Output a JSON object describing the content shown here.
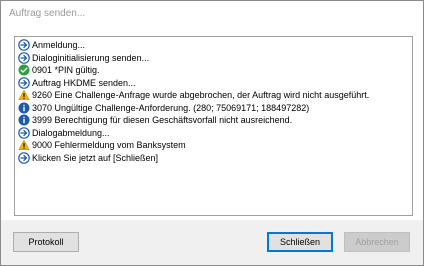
{
  "window": {
    "title": "Auftrag senden..."
  },
  "log": [
    {
      "icon": "arrow-right-icon",
      "text": "Anmeldung..."
    },
    {
      "icon": "arrow-right-icon",
      "text": "Dialoginitialisierung senden..."
    },
    {
      "icon": "checkmark-icon",
      "text": "0901 *PIN gültig."
    },
    {
      "icon": "arrow-right-icon",
      "text": "Auftrag HKDME senden..."
    },
    {
      "icon": "warning-icon",
      "text": "9260 Eine Challenge-Anfrage wurde abgebrochen, der Auftrag wird nicht ausgeführt."
    },
    {
      "icon": "info-icon",
      "text": "3070 Ungültige Challenge-Anforderung. (280; 75069171; 188497282)"
    },
    {
      "icon": "info-icon",
      "text": "3999 Berechtigung für diesen Geschäftsvorfall nicht ausreichend."
    },
    {
      "icon": "arrow-right-icon",
      "text": "Dialogabmeldung..."
    },
    {
      "icon": "warning-icon",
      "text": "9000 Fehlermeldung vom Banksystem"
    },
    {
      "icon": "arrow-right-icon",
      "text": "Klicken Sie jetzt auf [Schließen]"
    }
  ],
  "buttons": {
    "protokoll": "Protokoll",
    "schliessen": "Schließen",
    "abbrechen": "Abbrechen"
  },
  "colors": {
    "arrow": "#1e5aa8",
    "check": "#2e9e3e",
    "warning": "#f2b705",
    "info": "#1e5aa8"
  }
}
